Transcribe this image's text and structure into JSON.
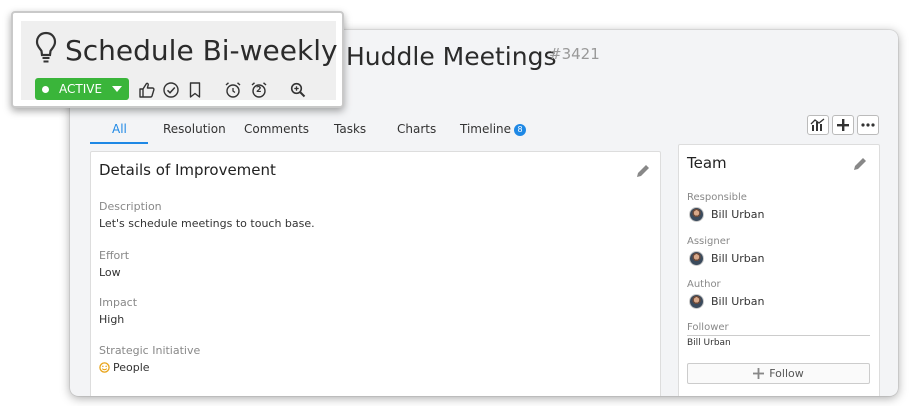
{
  "header": {
    "title": "Huddle Meetings",
    "id": "#3421"
  },
  "callout": {
    "title": "Schedule Bi-weekly",
    "status": "ACTIVE",
    "snooze_count": "2",
    "icons": [
      "lightbulb-icon",
      "thumbs-up-icon",
      "check-circle-icon",
      "bookmark-icon",
      "alarm-clock-icon",
      "alarm-clock-2-icon",
      "zoom-icon"
    ]
  },
  "tabs": [
    {
      "label": "All"
    },
    {
      "label": "Resolution"
    },
    {
      "label": "Comments"
    },
    {
      "label": "Tasks"
    },
    {
      "label": "Charts"
    },
    {
      "label": "Timeline",
      "badge": "8"
    }
  ],
  "toolbar": {
    "icons": [
      "bar-chart-icon",
      "plus-icon",
      "more-icon"
    ]
  },
  "details": {
    "title": "Details of Improvement",
    "fields": [
      {
        "label": "Description",
        "value": "Let's schedule meetings to touch base."
      },
      {
        "label": "Effort",
        "value": "Low"
      },
      {
        "label": "Impact",
        "value": "High"
      },
      {
        "label": "Strategic Initiative",
        "value": "People"
      }
    ]
  },
  "team": {
    "title": "Team",
    "responsible_label": "Responsible",
    "responsible": "Bill Urban",
    "assigner_label": "Assigner",
    "assigner": "Bill Urban",
    "author_label": "Author",
    "author": "Bill Urban",
    "follower_label": "Follower",
    "follower": "Bill Urban",
    "follow_label": "Follow"
  },
  "colors": {
    "accent": "#1e88e5",
    "status_active": "#3ab53a"
  }
}
